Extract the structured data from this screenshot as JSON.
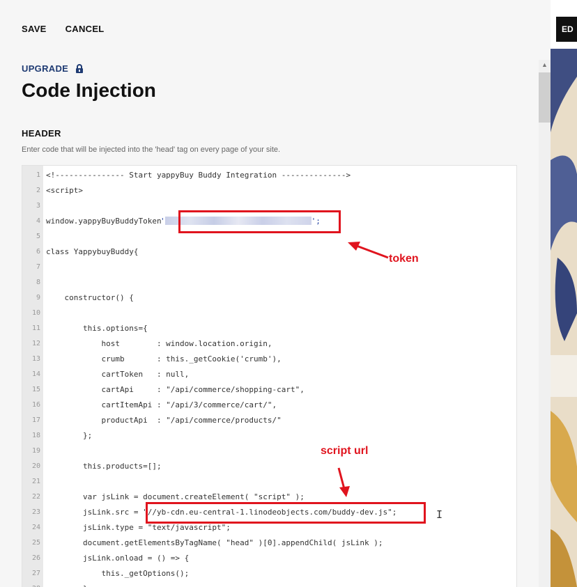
{
  "toolbar": {
    "save_label": "SAVE",
    "cancel_label": "CANCEL"
  },
  "upgrade": {
    "label": "UPGRADE",
    "icon": "lock-icon"
  },
  "page": {
    "title": "Code Injection"
  },
  "header_section": {
    "label": "HEADER",
    "description": "Enter code that will be injected into the 'head' tag on every page of your site."
  },
  "code_lines": [
    {
      "n": "1",
      "t": "<!--------------- Start yappyBuy Buddy Integration -------------->"
    },
    {
      "n": "2",
      "t": "<script>"
    },
    {
      "n": "3",
      "t": ""
    },
    {
      "n": "4",
      "t": "window.yappyBuyBuddyToken = "
    },
    {
      "n": "5",
      "t": ""
    },
    {
      "n": "6",
      "t": "class YappybuyBuddy{"
    },
    {
      "n": "7",
      "t": ""
    },
    {
      "n": "8",
      "t": ""
    },
    {
      "n": "9",
      "t": "    constructor() {"
    },
    {
      "n": "10",
      "t": ""
    },
    {
      "n": "11",
      "t": "        this.options={"
    },
    {
      "n": "12",
      "t": "            host        : window.location.origin,"
    },
    {
      "n": "13",
      "t": "            crumb       : this._getCookie('crumb'),"
    },
    {
      "n": "14",
      "t": "            cartToken   : null,"
    },
    {
      "n": "15",
      "t": "            cartApi     : \"/api/commerce/shopping-cart\","
    },
    {
      "n": "16",
      "t": "            cartItemApi : \"/api/3/commerce/cart/\","
    },
    {
      "n": "17",
      "t": "            productApi  : \"/api/commerce/products/\""
    },
    {
      "n": "18",
      "t": "        };"
    },
    {
      "n": "19",
      "t": ""
    },
    {
      "n": "20",
      "t": "        this.products=[];"
    },
    {
      "n": "21",
      "t": ""
    },
    {
      "n": "22",
      "t": "        var jsLink = document.createElement( \"script\" );"
    },
    {
      "n": "23",
      "t": "        jsLink.src = \"//yb-cdn.eu-central-1.linodeobjects.com/buddy-dev.js\";"
    },
    {
      "n": "24",
      "t": "        jsLink.type = \"text/javascript\";"
    },
    {
      "n": "25",
      "t": "        document.getElementsByTagName( \"head\" )[0].appendChild( jsLink );"
    },
    {
      "n": "26",
      "t": "        jsLink.onload = () => {"
    },
    {
      "n": "27",
      "t": "            this._getOptions();"
    },
    {
      "n": "28",
      "t": "        }"
    }
  ],
  "annotations": {
    "token_label": "token",
    "script_label": "script url"
  },
  "preview": {
    "edit_label": "ED"
  },
  "colors": {
    "accent": "#e0141e",
    "brand": "#1f3b73"
  }
}
